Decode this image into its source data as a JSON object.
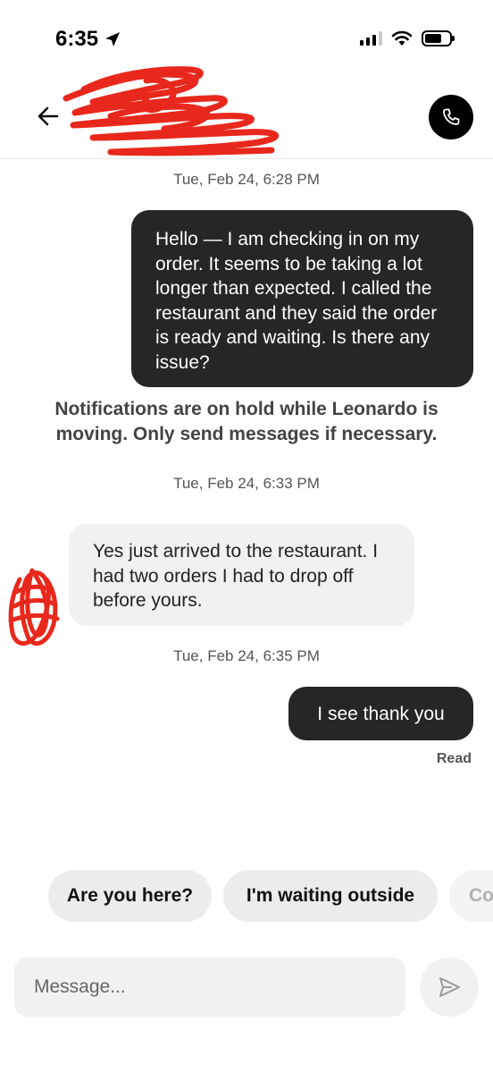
{
  "status_bar": {
    "time": "6:35",
    "location_icon": "location-arrow-icon",
    "signal_icon": "cellular-signal-icon",
    "wifi_icon": "wifi-icon",
    "battery_icon": "battery-icon"
  },
  "header": {
    "back_icon": "arrow-left-icon",
    "call_icon": "phone-icon",
    "redaction_color": "#e8281c"
  },
  "messages": [
    {
      "timestamp": "Tue, Feb 24, 6:28 PM"
    },
    {
      "direction": "outgoing",
      "text": "Hello — I am checking in on my order. It seems to be taking a lot longer than expected. I called the restaurant and they said the order is ready and waiting. Is there any issue?"
    },
    {
      "notice": "Notifications are on hold while Leonardo is moving. Only send messages if necessary."
    },
    {
      "timestamp": "Tue, Feb 24, 6:33 PM"
    },
    {
      "direction": "incoming",
      "text": "Yes just arrived to the restaurant. I had two orders I had to drop off before yours."
    },
    {
      "timestamp": "Tue, Feb 24, 6:35 PM"
    },
    {
      "direction": "outgoing",
      "text": "I see thank you",
      "status": "Read"
    }
  ],
  "quick_replies": [
    "Are you here?",
    "I'm waiting outside",
    "Co"
  ],
  "composer": {
    "placeholder": "Message...",
    "send_icon": "send-icon"
  },
  "colors": {
    "outgoing_bubble": "#262626",
    "incoming_bubble": "#f1f1f1",
    "chip_background": "#ececec"
  }
}
